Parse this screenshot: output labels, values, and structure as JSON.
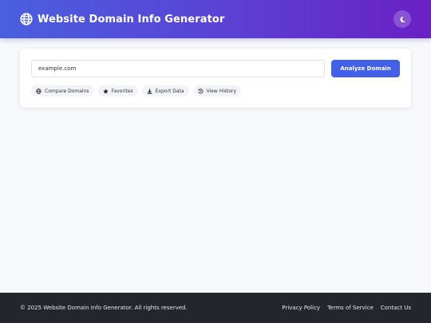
{
  "header": {
    "title": "Website Domain Info Generator",
    "logo_icon": "globe-icon",
    "theme_toggle_icon": "moon-icon"
  },
  "search": {
    "value": "example.com",
    "button_label": "Analyze Domain"
  },
  "actions": [
    {
      "label": "Compare Domains",
      "icon": "globe-icon"
    },
    {
      "label": "Favorites",
      "icon": "star-icon"
    },
    {
      "label": "Export Data",
      "icon": "download-icon"
    },
    {
      "label": "View History",
      "icon": "history-icon"
    }
  ],
  "footer": {
    "copyright": "© 2025 Website Domain Info Generator. All rights reserved.",
    "links": [
      "Privacy Policy",
      "Terms of Service",
      "Contact Us"
    ]
  },
  "colors": {
    "header_gradient_start": "#4a5fe0",
    "header_gradient_end": "#6a1fc4",
    "primary_button": "#4361e8",
    "footer_bg": "#23272c",
    "page_bg": "#f7f8fb"
  }
}
